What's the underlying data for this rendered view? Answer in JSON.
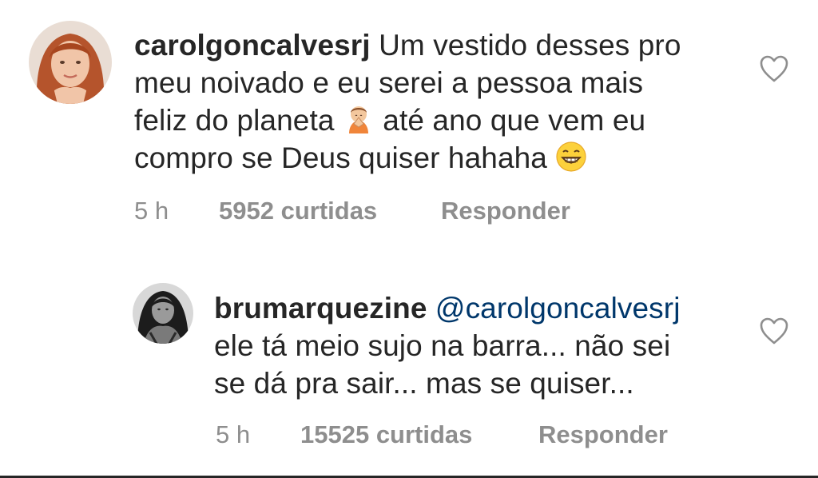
{
  "comments": [
    {
      "username": "carolgoncalvesrj",
      "lines": [
        "Um vestido desses pro",
        "meu noivado e eu serei a pessoa mais",
        "feliz do planeta",
        "até ano que vem eu",
        "compro se Deus quiser hahaha"
      ],
      "time": "5 h",
      "likes": "5952 curtidas",
      "reply": "Responder",
      "emojis": [
        "person-bowing-emoji",
        "grinning-face-emoji"
      ]
    },
    {
      "username": "brumarquezine",
      "mention": "@carolgoncalvesrj",
      "lines": [
        "ele tá meio sujo na barra... não sei",
        "se dá pra sair... mas se quiser..."
      ],
      "time": "5 h",
      "likes": "15525 curtidas",
      "reply": "Responder"
    }
  ],
  "colors": {
    "text": "#262626",
    "meta": "#8e8e8e",
    "mention": "#00376b"
  }
}
